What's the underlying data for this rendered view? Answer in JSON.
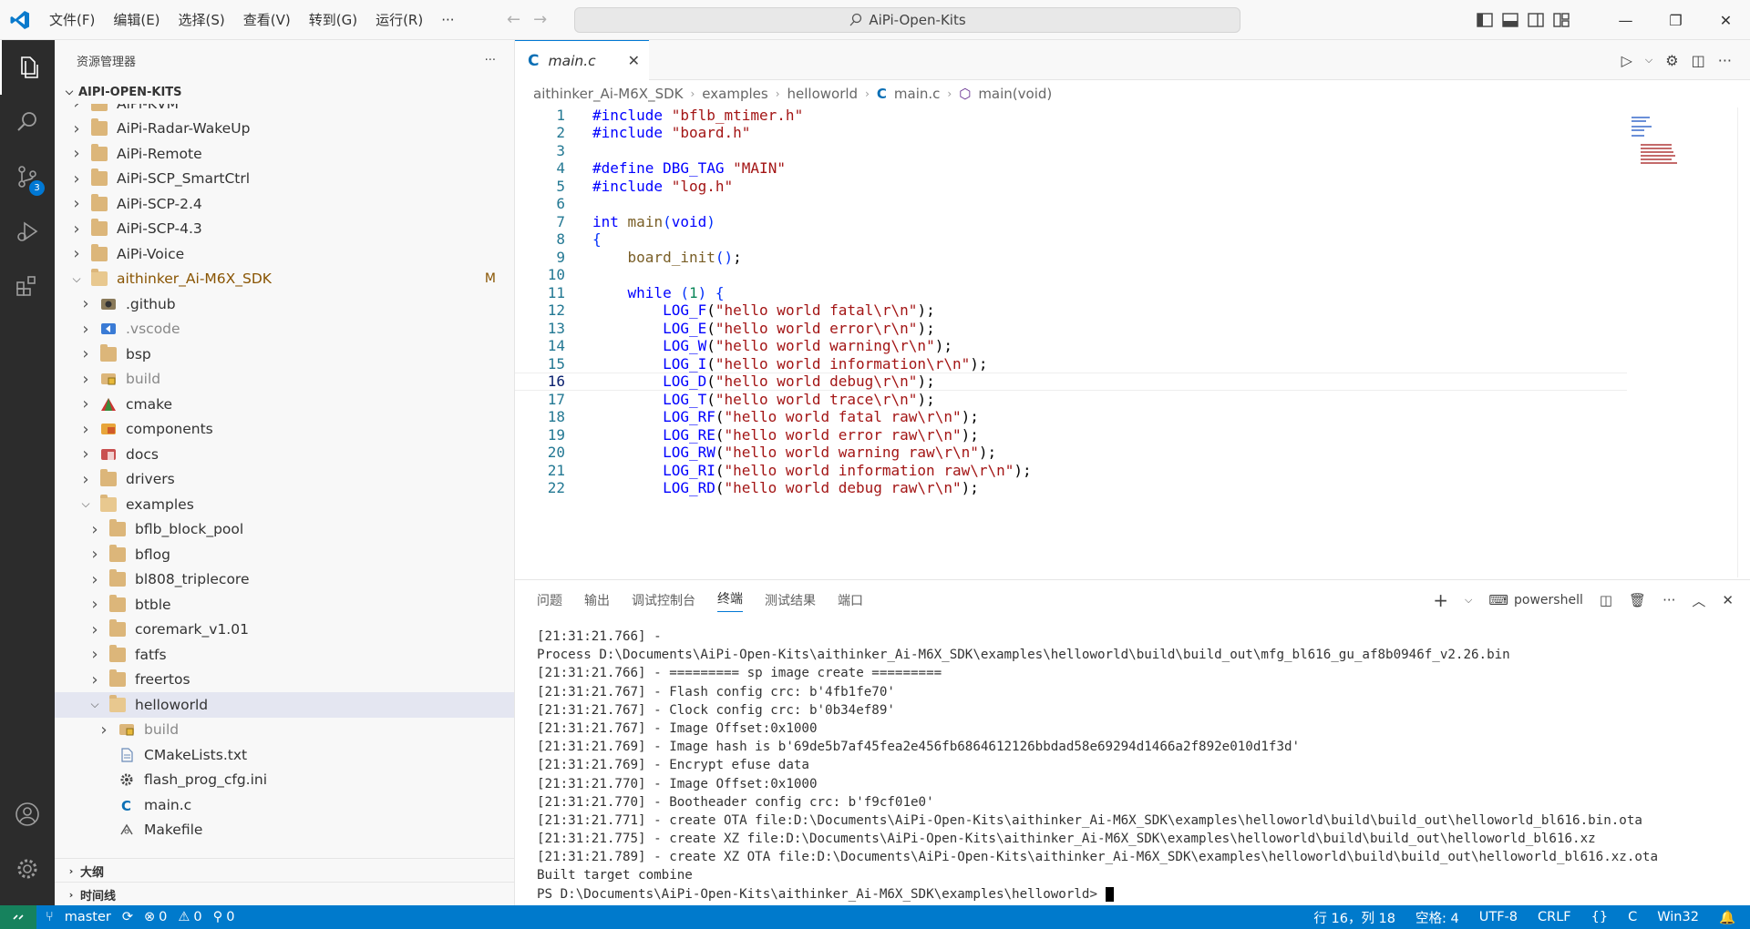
{
  "titlebar": {
    "menu": [
      "文件(F)",
      "编辑(E)",
      "选择(S)",
      "查看(V)",
      "转到(G)",
      "运行(R)",
      "···"
    ],
    "search_text": "AiPi-Open-Kits"
  },
  "activity": {
    "scm_badge": "3"
  },
  "sidebar": {
    "title": "资源管理器",
    "more": "···",
    "root": "AIPI-OPEN-KITS",
    "tree": [
      {
        "label": "AiPi-KVM",
        "depth": 0,
        "type": "folder",
        "partial": true
      },
      {
        "label": "AiPi-Radar-WakeUp",
        "depth": 0,
        "type": "folder"
      },
      {
        "label": "AiPi-Remote",
        "depth": 0,
        "type": "folder"
      },
      {
        "label": "AiPi-SCP_SmartCtrl",
        "depth": 0,
        "type": "folder"
      },
      {
        "label": "AiPi-SCP-2.4",
        "depth": 0,
        "type": "folder"
      },
      {
        "label": "AiPi-SCP-4.3",
        "depth": 0,
        "type": "folder"
      },
      {
        "label": "AiPi-Voice",
        "depth": 0,
        "type": "folder"
      },
      {
        "label": "aithinker_Ai-M6X_SDK",
        "depth": 0,
        "type": "folder-open",
        "modified": "M"
      },
      {
        "label": ".github",
        "depth": 1,
        "type": "github"
      },
      {
        "label": ".vscode",
        "depth": 1,
        "type": "vscode",
        "dim": true
      },
      {
        "label": "bsp",
        "depth": 1,
        "type": "folder"
      },
      {
        "label": "build",
        "depth": 1,
        "type": "build",
        "dim": true
      },
      {
        "label": "cmake",
        "depth": 1,
        "type": "cmake"
      },
      {
        "label": "components",
        "depth": 1,
        "type": "components"
      },
      {
        "label": "docs",
        "depth": 1,
        "type": "docs"
      },
      {
        "label": "drivers",
        "depth": 1,
        "type": "folder"
      },
      {
        "label": "examples",
        "depth": 1,
        "type": "folder-open"
      },
      {
        "label": "bflb_block_pool",
        "depth": 2,
        "type": "folder"
      },
      {
        "label": "bflog",
        "depth": 2,
        "type": "folder"
      },
      {
        "label": "bl808_triplecore",
        "depth": 2,
        "type": "folder"
      },
      {
        "label": "btble",
        "depth": 2,
        "type": "folder"
      },
      {
        "label": "coremark_v1.01",
        "depth": 2,
        "type": "folder"
      },
      {
        "label": "fatfs",
        "depth": 2,
        "type": "folder"
      },
      {
        "label": "freertos",
        "depth": 2,
        "type": "folder"
      },
      {
        "label": "helloworld",
        "depth": 2,
        "type": "folder-open",
        "selected": true
      },
      {
        "label": "build",
        "depth": 3,
        "type": "build",
        "dim": true
      },
      {
        "label": "CMakeLists.txt",
        "depth": 3,
        "type": "file-txt",
        "leaf": true
      },
      {
        "label": "flash_prog_cfg.ini",
        "depth": 3,
        "type": "file-gear",
        "leaf": true
      },
      {
        "label": "main.c",
        "depth": 3,
        "type": "file-c",
        "leaf": true
      },
      {
        "label": "Makefile",
        "depth": 3,
        "type": "file-make",
        "leaf": true
      }
    ],
    "outline": "大纲",
    "timeline": "时间线"
  },
  "editor": {
    "tab": {
      "icon": "C",
      "label": "main.c"
    },
    "breadcrumb": [
      "aithinker_Ai-M6X_SDK",
      "examples",
      "helloworld",
      "main.c",
      "main(void)"
    ],
    "current_line": 16,
    "lines": [
      {
        "n": "1",
        "html": "<span class=\"mac\">#include</span> <span class=\"str\">\"bflb_mtimer.h\"</span>"
      },
      {
        "n": "2",
        "html": "<span class=\"mac\">#include</span> <span class=\"str\">\"board.h\"</span>"
      },
      {
        "n": "3",
        "html": ""
      },
      {
        "n": "4",
        "html": "<span class=\"mac\">#define</span> <span class=\"mac\">DBG_TAG</span> <span class=\"str\">\"MAIN\"</span>"
      },
      {
        "n": "5",
        "html": "<span class=\"mac\">#include</span> <span class=\"str\">\"log.h\"</span>"
      },
      {
        "n": "6",
        "html": ""
      },
      {
        "n": "7",
        "html": "<span class=\"kw\">int</span> <span class=\"fn\">main</span><span class=\"pn\">(</span><span class=\"kw\">void</span><span class=\"pn\">)</span>"
      },
      {
        "n": "8",
        "html": "<span class=\"pn\">{</span>"
      },
      {
        "n": "9",
        "html": "    <span class=\"fn\">board_init</span><span class=\"pn\">()</span>;"
      },
      {
        "n": "10",
        "html": ""
      },
      {
        "n": "11",
        "html": "    <span class=\"kw\">while</span> <span class=\"pn\">(</span><span class=\"num\">1</span><span class=\"pn\">)</span> <span class=\"pn\">{</span>"
      },
      {
        "n": "12",
        "html": "        <span class=\"mac\">LOG_F</span>(<span class=\"str\">\"hello world fatal\\r\\n\"</span>);"
      },
      {
        "n": "13",
        "html": "        <span class=\"mac\">LOG_E</span>(<span class=\"str\">\"hello world error\\r\\n\"</span>);"
      },
      {
        "n": "14",
        "html": "        <span class=\"mac\">LOG_W</span>(<span class=\"str\">\"hello world warning\\r\\n\"</span>);"
      },
      {
        "n": "15",
        "html": "        <span class=\"mac\">LOG_I</span>(<span class=\"str\">\"hello world information\\r\\n\"</span>);"
      },
      {
        "n": "16",
        "html": "        <span class=\"mac\">LOG_D</span>(<span class=\"str\">\"hello world debug\\r\\n\"</span>);"
      },
      {
        "n": "17",
        "html": "        <span class=\"mac\">LOG_T</span>(<span class=\"str\">\"hello world trace\\r\\n\"</span>);"
      },
      {
        "n": "18",
        "html": "        <span class=\"mac\">LOG_RF</span>(<span class=\"str\">\"hello world fatal raw\\r\\n\"</span>);"
      },
      {
        "n": "19",
        "html": "        <span class=\"mac\">LOG_RE</span>(<span class=\"str\">\"hello world error raw\\r\\n\"</span>);"
      },
      {
        "n": "20",
        "html": "        <span class=\"mac\">LOG_RW</span>(<span class=\"str\">\"hello world warning raw\\r\\n\"</span>);"
      },
      {
        "n": "21",
        "html": "        <span class=\"mac\">LOG_RI</span>(<span class=\"str\">\"hello world information raw\\r\\n\"</span>);"
      },
      {
        "n": "22",
        "html": "        <span class=\"mac\">LOG_RD</span>(<span class=\"str\">\"hello world debug raw\\r\\n\"</span>);"
      }
    ]
  },
  "panel": {
    "tabs": [
      "问题",
      "输出",
      "调试控制台",
      "终端",
      "测试结果",
      "端口"
    ],
    "active_tab": "终端",
    "shell": "powershell",
    "terminal": [
      "[21:31:21.766] -",
      "Process D:\\Documents\\AiPi-Open-Kits\\aithinker_Ai-M6X_SDK\\examples\\helloworld\\build\\build_out\\mfg_bl616_gu_af8b0946f_v2.26.bin",
      "[21:31:21.766] - ========= sp image create =========",
      "[21:31:21.767] - Flash config crc: b'4fb1fe70'",
      "[21:31:21.767] - Clock config crc: b'0b34ef89'",
      "[21:31:21.767] - Image Offset:0x1000",
      "[21:31:21.769] - Image hash is b'69de5b7af45fea2e456fb6864612126bbdad58e69294d1466a2f892e010d1f3d'",
      "[21:31:21.769] - Encrypt efuse data",
      "[21:31:21.770] - Image Offset:0x1000",
      "[21:31:21.770] - Bootheader config crc: b'f9cf01e0'",
      "[21:31:21.771] - create OTA file:D:\\Documents\\AiPi-Open-Kits\\aithinker_Ai-M6X_SDK\\examples\\helloworld\\build\\build_out\\helloworld_bl616.bin.ota",
      "[21:31:21.775] - create XZ file:D:\\Documents\\AiPi-Open-Kits\\aithinker_Ai-M6X_SDK\\examples\\helloworld\\build\\build_out\\helloworld_bl616.xz",
      "[21:31:21.789] - create XZ OTA file:D:\\Documents\\AiPi-Open-Kits\\aithinker_Ai-M6X_SDK\\examples\\helloworld\\build\\build_out\\helloworld_bl616.xz.ota",
      "Built target combine"
    ],
    "prompt": "PS D:\\Documents\\AiPi-Open-Kits\\aithinker_Ai-M6X_SDK\\examples\\helloworld> "
  },
  "status": {
    "branch": "master",
    "errors": "0",
    "warnings": "0",
    "ports": "0",
    "position": "行 16，列 18",
    "spaces": "空格: 4",
    "encoding": "UTF-8",
    "eol": "CRLF",
    "lang_braces": "{}",
    "language": "C",
    "platform": "Win32"
  },
  "colors": {
    "accent": "#007acc",
    "folder": "#dcb67a"
  }
}
